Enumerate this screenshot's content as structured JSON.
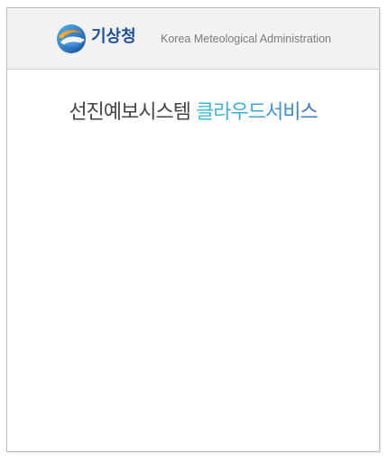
{
  "header": {
    "logo_text": "기상청",
    "org_name": "Korea Meteological Administration"
  },
  "title": {
    "main": "선진예보시스템",
    "accent": "클라우드서비스"
  },
  "colors": {
    "logo_text": "#1d4f9c",
    "title_main": "#444444",
    "title_accent_start": "#3fbfd6",
    "title_accent_end": "#3a72c6",
    "header_bg": "#f2f2f2",
    "border": "#bdbdbd"
  },
  "icons": {
    "logo": "kma-logo-icon"
  }
}
